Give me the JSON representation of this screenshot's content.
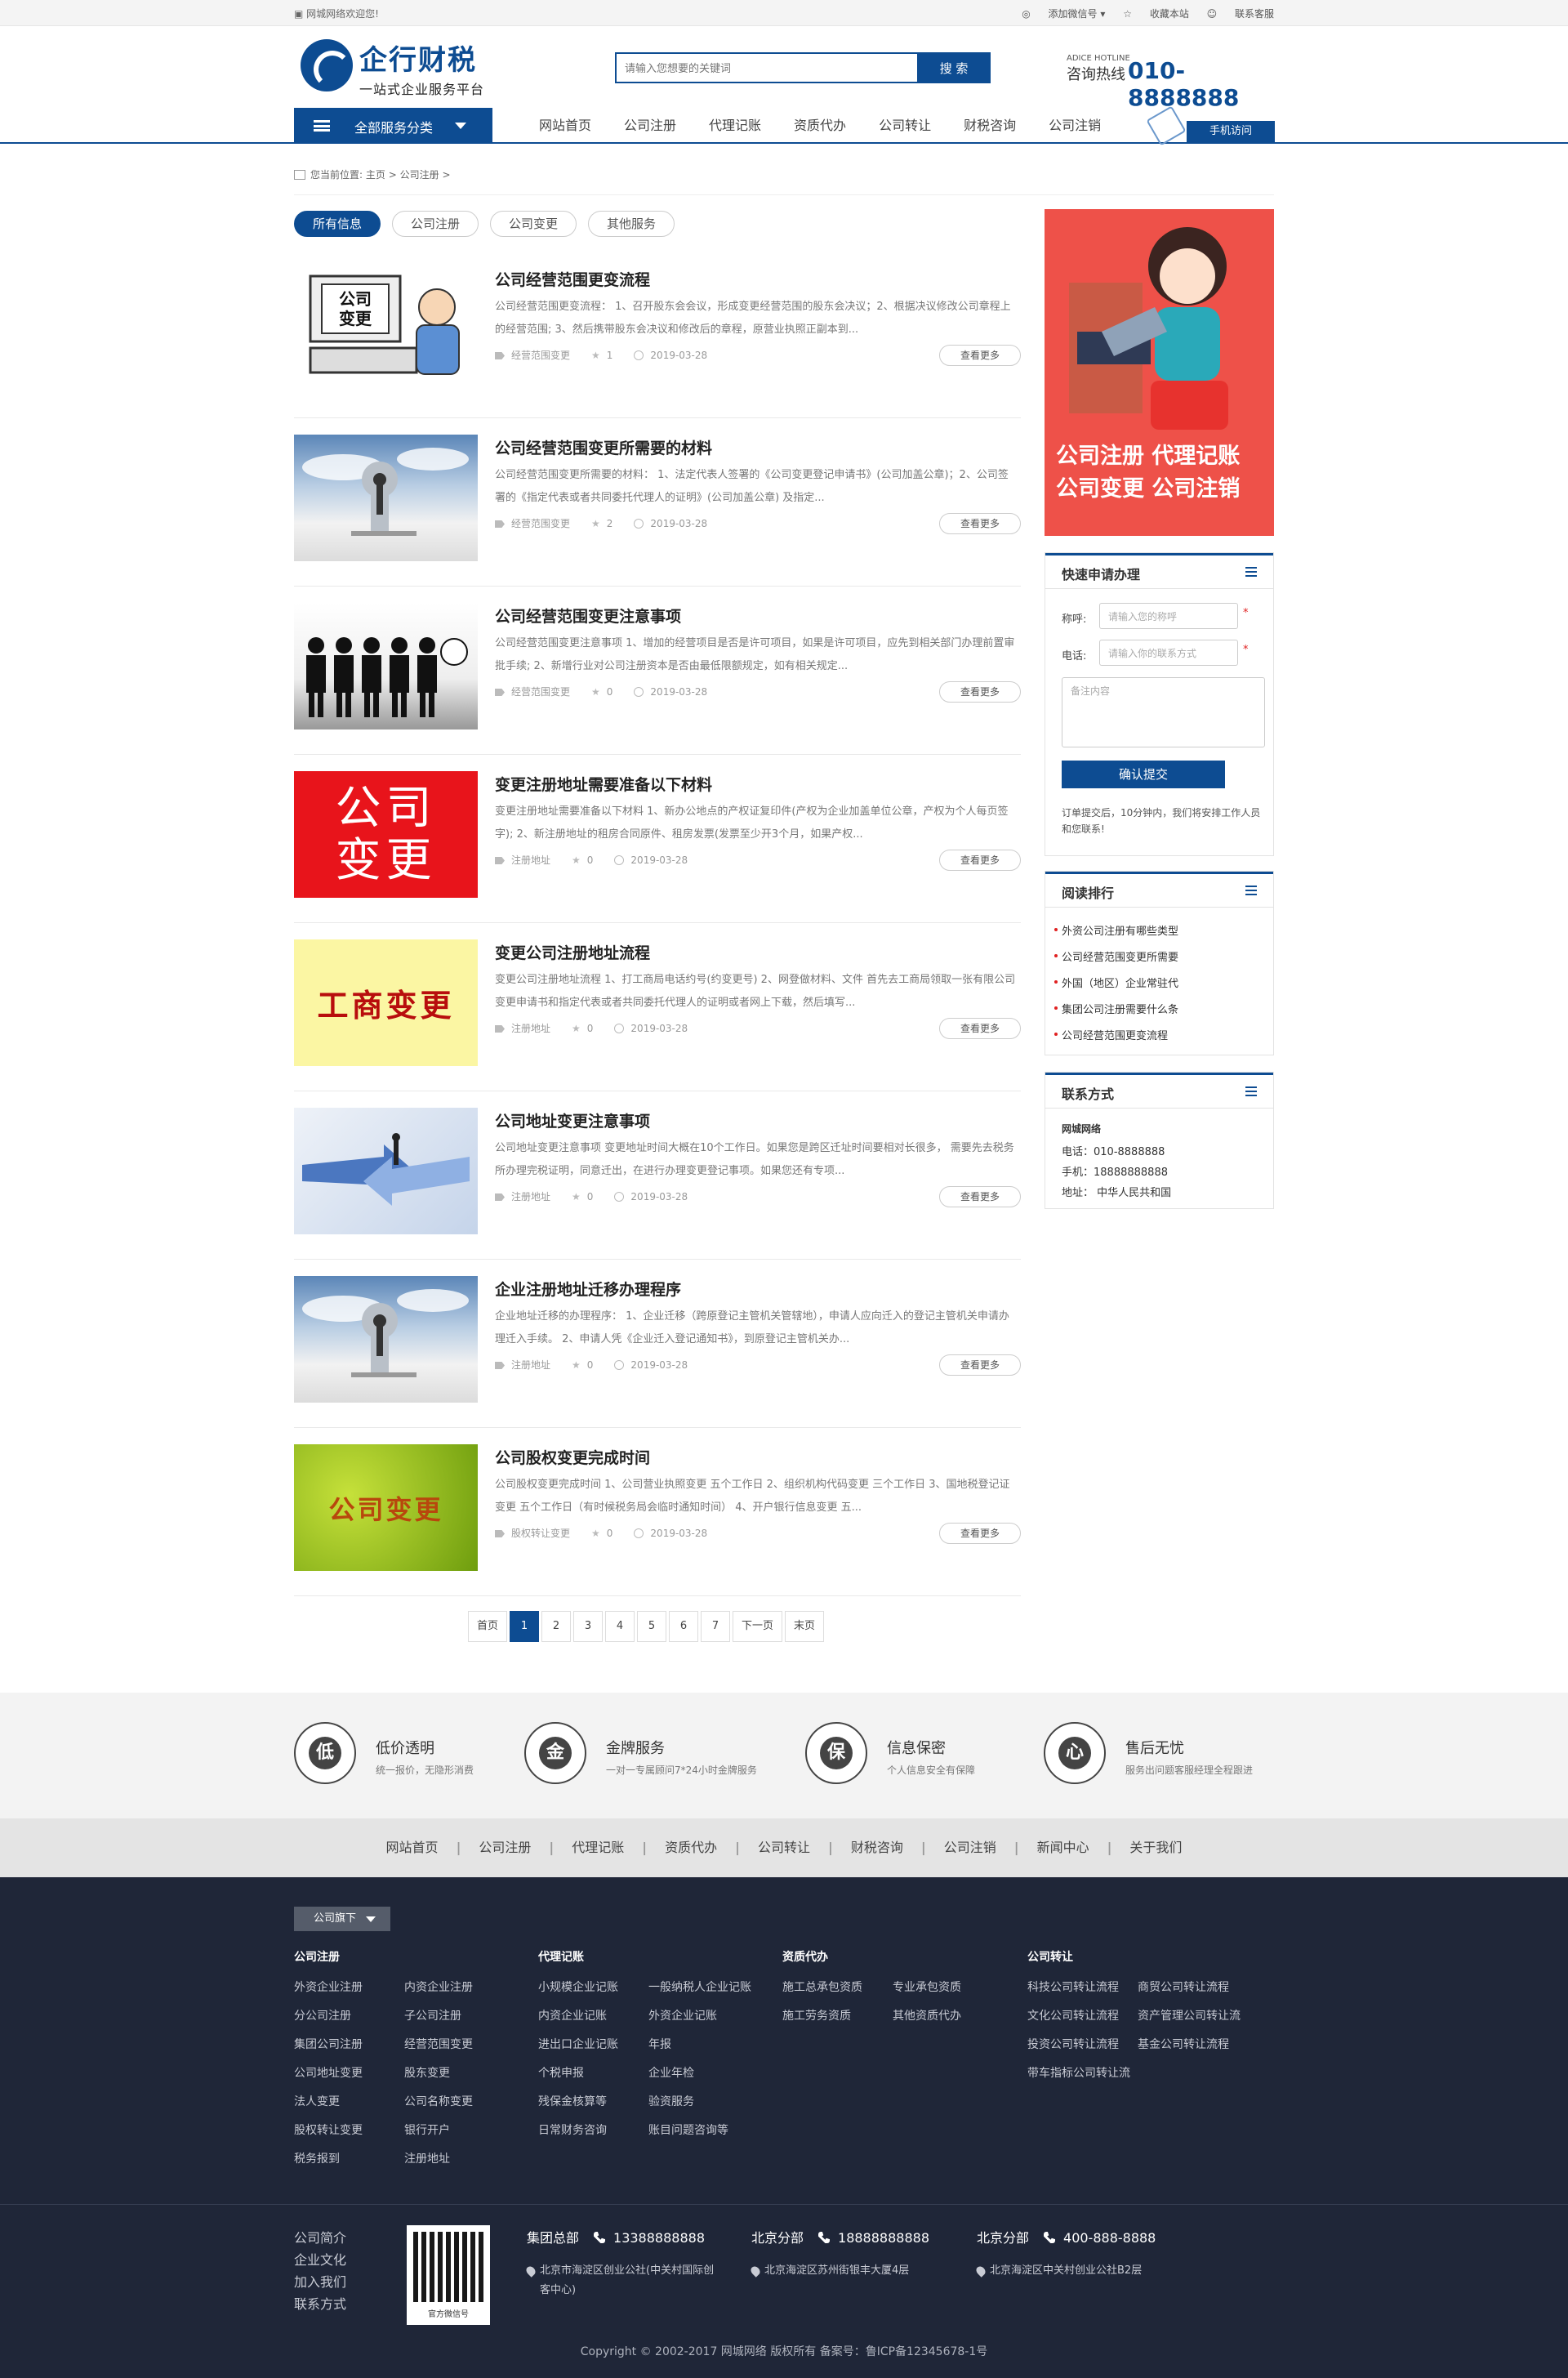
{
  "topbar": {
    "welcome": "网城网络欢迎您!",
    "wechat": "添加微信号",
    "favorite": "收藏本站",
    "service": "联系客服"
  },
  "logo": {
    "name": "企行财税",
    "sub": "一站式企业服务平台"
  },
  "search": {
    "placeholder": "请输入您想要的关键词",
    "button": "搜 索"
  },
  "hotline": {
    "en": "ADICE HOTLINE",
    "label": "咨询热线",
    "number": "010-8888888"
  },
  "nav": {
    "all_services": "全部服务分类",
    "items": [
      "网站首页",
      "公司注册",
      "代理记账",
      "资质代办",
      "公司转让",
      "财税咨询",
      "公司注销"
    ],
    "mobile": "手机访问"
  },
  "breadcrumb": {
    "prefix": "您当前位置:",
    "home": "主页",
    "sep1": ">",
    "current": "公司注册",
    "sep2": ">"
  },
  "filters": [
    "所有信息",
    "公司注册",
    "公司变更",
    "其他服务"
  ],
  "articles": [
    {
      "title": "公司经营范围更变流程",
      "desc": "公司经营范围更变流程： 1、召开股东会会议，形成变更经营范围的股东会决议；2、根据决议修改公司章程上的经营范围; 3、然后携带股东会决议和修改后的章程，原营业执照正副本到...",
      "tag": "经营范围变更",
      "likes": "1",
      "date": "2019-03-28",
      "more": "查看更多",
      "thumb_text": "公司变更"
    },
    {
      "title": "公司经营范围变更所需要的材料",
      "desc": "公司经营范围变更所需要的材料： 1、法定代表人签署的《公司变更登记申请书》(公司加盖公章)；2、公司签署的《指定代表或者共同委托代理人的证明》(公司加盖公章) 及指定...",
      "tag": "经营范围变更",
      "likes": "2",
      "date": "2019-03-28",
      "more": "查看更多",
      "thumb_text": ""
    },
    {
      "title": "公司经营范围变更注意事项",
      "desc": "公司经营范围变更注意事项 1、增加的经营项目是否是许可项目，如果是许可项目，应先到相关部门办理前置审批手续; 2、新增行业对公司注册资本是否由最低限额规定，如有相关规定...",
      "tag": "经营范围变更",
      "likes": "0",
      "date": "2019-03-28",
      "more": "查看更多",
      "thumb_text": ""
    },
    {
      "title": "变更注册地址需要准备以下材料",
      "desc": "变更注册地址需要准备以下材料 1、新办公地点的产权证复印件(产权为企业加盖单位公章，产权为个人每页签字); 2、新注册地址的租房合同原件、租房发票(发票至少开3个月，如果产权...",
      "tag": "注册地址",
      "likes": "0",
      "date": "2019-03-28",
      "more": "查看更多",
      "thumb_text": "公司变更"
    },
    {
      "title": "变更公司注册地址流程",
      "desc": "变更公司注册地址流程 1、打工商局电话约号(约变更号) 2、网登做材料、文件 首先去工商局领取一张有限公司变更申请书和指定代表或者共同委托代理人的证明或者网上下载，然后填写...",
      "tag": "注册地址",
      "likes": "0",
      "date": "2019-03-28",
      "more": "查看更多",
      "thumb_text": "工商变更"
    },
    {
      "title": "公司地址变更注意事项",
      "desc": "公司地址变更注意事项 变更地址时间大概在10个工作日。如果您是跨区迁址时间要相对长很多， 需要先去税务所办理完税证明，同意迁出，在进行办理变更登记事项。如果您还有专项...",
      "tag": "注册地址",
      "likes": "0",
      "date": "2019-03-28",
      "more": "查看更多",
      "thumb_text": ""
    },
    {
      "title": "企业注册地址迁移办理程序",
      "desc": "企业地址迁移的办理程序： 1、企业迁移（跨原登记主管机关管辖地），申请人应向迁入的登记主管机关申请办理迁入手续。 2、申请人凭《企业迁入登记通知书》，到原登记主管机关办...",
      "tag": "注册地址",
      "likes": "0",
      "date": "2019-03-28",
      "more": "查看更多",
      "thumb_text": ""
    },
    {
      "title": "公司股权变更完成时间",
      "desc": "公司股权变更完成时间 1、公司营业执照变更 五个工作日 2、组织机构代码变更 三个工作日 3、国地税登记证变更 五个工作日（有时候税务局会临时通知时间） 4、开户银行信息变更 五...",
      "tag": "股权转让变更",
      "likes": "0",
      "date": "2019-03-28",
      "more": "查看更多",
      "thumb_text": "公司变更"
    }
  ],
  "pagination": [
    "首页",
    "1",
    "2",
    "3",
    "4",
    "5",
    "6",
    "7",
    "下一页",
    "末页"
  ],
  "banner": {
    "line1": "公司注册 代理记账",
    "line2": "公司变更 公司注销"
  },
  "quick_apply": {
    "title": "快速申请办理",
    "name_label": "称呼:",
    "name_placeholder": "请输入您的称呼",
    "phone_label": "电话:",
    "phone_placeholder": "请输入你的联系方式",
    "remark_placeholder": "备注内容",
    "submit": "确认提交",
    "note": "订单提交后，10分钟内，我们将安排工作人员和您联系!"
  },
  "ranking": {
    "title": "阅读排行",
    "items": [
      "外资公司注册有哪些类型",
      "公司经营范围变更所需要",
      "外国（地区）企业常驻代",
      "集团公司注册需要什么条",
      "公司经营范围更变流程"
    ]
  },
  "contact": {
    "title": "联系方式",
    "company": "网城网络",
    "phone": "电话：010-8888888",
    "mobile": "手机：18888888888",
    "address": "地址： 中华人民共和国"
  },
  "features": [
    {
      "icon": "低",
      "title": "低价透明",
      "desc": "统一报价，无隐形消费"
    },
    {
      "icon": "金",
      "title": "金牌服务",
      "desc": "一对一专属顾问7*24小时金牌服务"
    },
    {
      "icon": "保",
      "title": "信息保密",
      "desc": "个人信息安全有保障"
    },
    {
      "icon": "心",
      "title": "售后无忧",
      "desc": "服务出问题客服经理全程跟进"
    }
  ],
  "footer_nav": [
    "网站首页",
    "公司注册",
    "代理记账",
    "资质代办",
    "公司转让",
    "财税咨询",
    "公司注销",
    "新闻中心",
    "关于我们"
  ],
  "company_btn": "公司旗下",
  "footer_cols": [
    {
      "title": "公司注册",
      "items": [
        "外资企业注册",
        "内资企业注册",
        "分公司注册",
        "子公司注册",
        "集团公司注册",
        "经营范围变更",
        "公司地址变更",
        "股东变更",
        "法人变更",
        "公司名称变更",
        "股权转让变更",
        "银行开户",
        "税务报到",
        "注册地址"
      ]
    },
    {
      "title": "代理记账",
      "items": [
        "小规模企业记账",
        "一般纳税人企业记账",
        "内资企业记账",
        "外资企业记账",
        "进出口企业记账",
        "年报",
        "个税申报",
        "企业年检",
        "残保金核算等",
        "验资服务",
        "日常财务咨询",
        "账目问题咨询等"
      ]
    },
    {
      "title": "资质代办",
      "items": [
        "施工总承包资质",
        "专业承包资质",
        "施工劳务资质",
        "其他资质代办"
      ]
    },
    {
      "title": "公司转让",
      "items": [
        "科技公司转让流程",
        "商贸公司转让流程",
        "文化公司转让流程",
        "资产管理公司转让流",
        "投资公司转让流程",
        "基金公司转让流程",
        "带车指标公司转让流"
      ]
    }
  ],
  "bottom_links": [
    "公司简介",
    "企业文化",
    "加入我们",
    "联系方式"
  ],
  "qr_label": "官方微信号",
  "branches": [
    {
      "name": "集团总部",
      "phone": "13388888888",
      "address": "北京市海淀区创业公社(中关村国际创客中心)"
    },
    {
      "name": "北京分部",
      "phone": "18888888888",
      "address": "北京海淀区苏州街银丰大厦4层"
    },
    {
      "name": "北京分部",
      "phone": "400-888-8888",
      "address": "北京海淀区中关村创业公社B2层"
    }
  ],
  "copyright": "Copyright © 2002-2017 网城网络 版权所有 备案号：鲁ICP备12345678-1号",
  "colors": {
    "primary": "#0d4c92",
    "banner": "#ee5149",
    "footer": "#1f2638"
  }
}
